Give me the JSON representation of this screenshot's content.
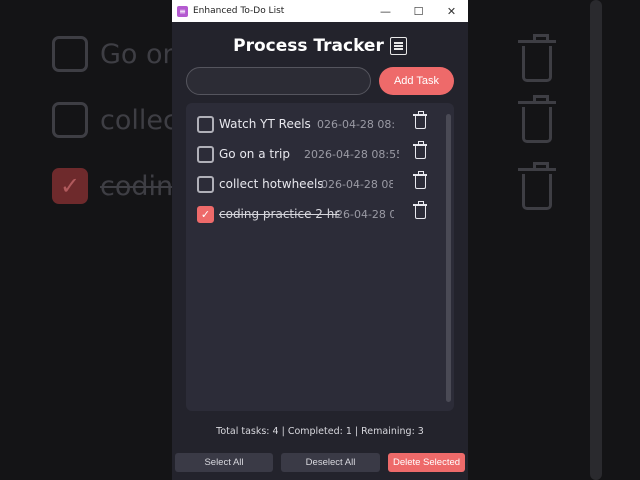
{
  "background": {
    "rows": [
      {
        "text": "Go on",
        "checked": false
      },
      {
        "text": "collect",
        "checked": false
      },
      {
        "text": "coding",
        "checked": true
      }
    ]
  },
  "window": {
    "title": "Enhanced To-Do List",
    "controls": {
      "minimize": "—",
      "maximize": "☐",
      "close": "✕"
    }
  },
  "header": {
    "title": "Process Tracker",
    "icon": "memo-icon"
  },
  "input": {
    "value": "",
    "add_label": "Add Task"
  },
  "tasks": [
    {
      "text": "Watch YT Reels",
      "date": "026-04-28 08:5",
      "checked": false
    },
    {
      "text": "Go on a trip",
      "date": "2026-04-28 08:55",
      "checked": false
    },
    {
      "text": "collect hotwheels",
      "date": "026-04-28 08:5",
      "checked": false
    },
    {
      "text": "coding practice 2 hr",
      "date": "26-04-28 08",
      "checked": true
    }
  ],
  "status": "Total tasks: 4 | Completed: 1 | Remaining: 3",
  "buttons": {
    "select_all": "Select All",
    "deselect_all": "Deselect All",
    "delete_selected": "Delete Selected"
  },
  "colors": {
    "accent": "#ee6a6a",
    "window_bg": "#23232c",
    "panel_bg": "#2c2c38"
  }
}
